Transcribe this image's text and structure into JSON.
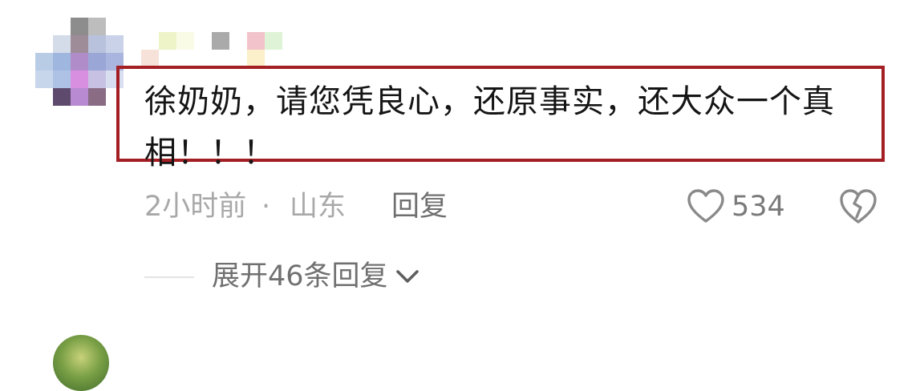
{
  "comment": {
    "text": "徐奶奶，请您凭良心，还原事实，还大众一个真相！！！",
    "time": "2小时前",
    "separator": "·",
    "location": "山东",
    "reply_label": "回复",
    "like_count": "534",
    "expand_replies_label": "展开46条回复"
  },
  "colors": {
    "highlight_border": "#a31f24",
    "meta_gray": "#a8a8a8",
    "text_dark": "#151515"
  },
  "icons": {
    "like": "heart-outline-icon",
    "dislike": "broken-heart-icon",
    "expand": "chevron-down-icon"
  }
}
